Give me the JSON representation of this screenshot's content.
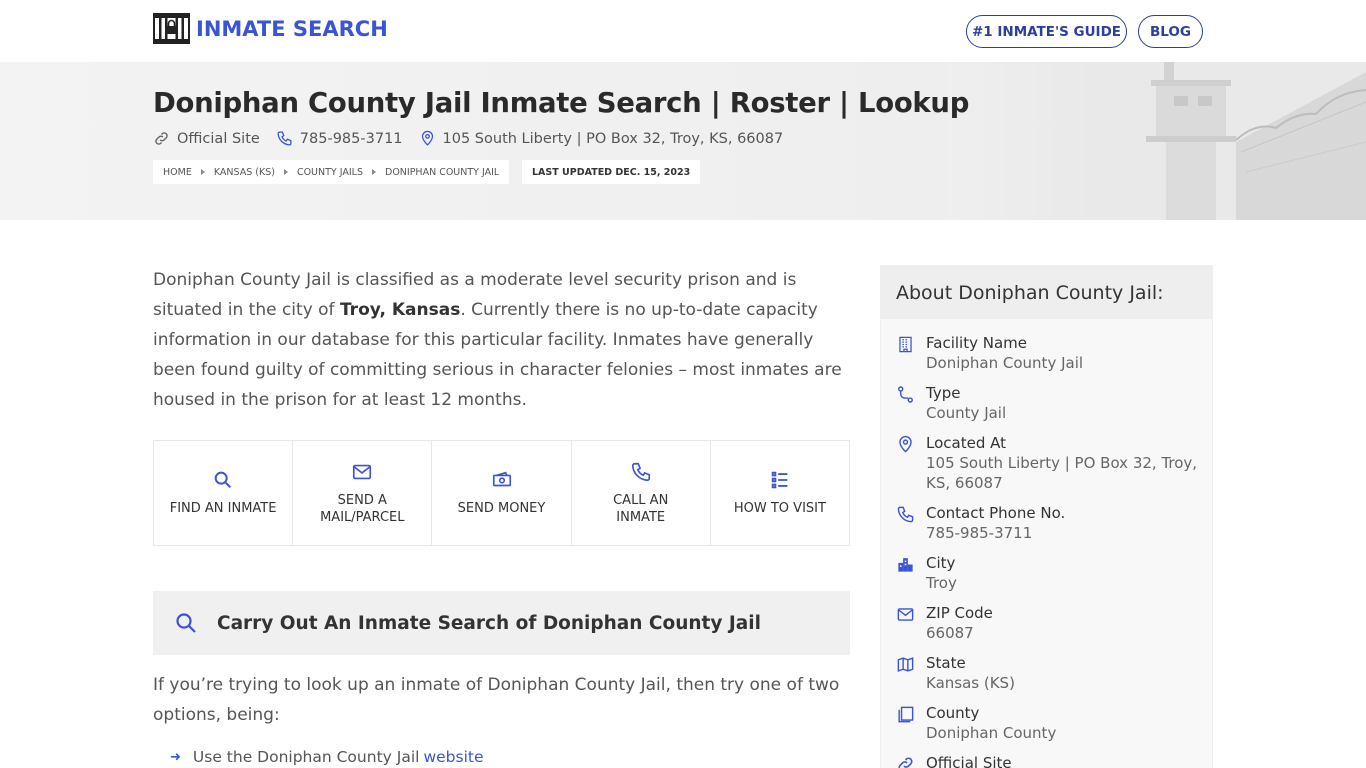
{
  "brand": {
    "name": "INMATE SEARCH"
  },
  "nav": {
    "guide": "#1 INMATE'S GUIDE",
    "blog": "BLOG"
  },
  "hero": {
    "title": "Doniphan County Jail Inmate Search | Roster | Lookup",
    "official_site": "Official Site",
    "phone": "785-985-3711",
    "address": "105 South Liberty | PO Box 32, Troy, KS, 66087",
    "breadcrumbs": [
      "HOME",
      "KANSAS (KS)",
      "COUNTY JAILS",
      "DONIPHAN COUNTY JAIL"
    ],
    "updated": "LAST UPDATED DEC. 15, 2023"
  },
  "intro": {
    "part1": "Doniphan County Jail is classified as a moderate level security prison and is situated in the city of ",
    "bold": "Troy, Kansas",
    "part2": ". Currently there is no up-to-date capacity information in our database for this particular facility. Inmates have generally been found guilty of committing serious in character felonies – most inmates are housed in the prison for at least 12 months."
  },
  "actions": [
    {
      "label": "FIND AN INMATE",
      "icon": "search-icon"
    },
    {
      "label": "SEND A MAIL/PARCEL",
      "icon": "mail-icon"
    },
    {
      "label": "SEND MONEY",
      "icon": "money-icon"
    },
    {
      "label": "CALL AN INMATE",
      "icon": "phone-icon"
    },
    {
      "label": "HOW TO VISIT",
      "icon": "list-icon"
    }
  ],
  "search_section": {
    "title": "Carry Out An Inmate Search of Doniphan County Jail"
  },
  "para2": "If you’re trying to look up an inmate of Doniphan County Jail, then try one of two options, being:",
  "bullet": {
    "text": "Use the Doniphan County Jail",
    "link": "website"
  },
  "sidebar": {
    "title": "About Doniphan County Jail:",
    "facts": [
      {
        "label": "Facility Name",
        "value": "Doniphan County Jail",
        "icon": "building-icon"
      },
      {
        "label": "Type",
        "value": "County Jail",
        "icon": "route-icon"
      },
      {
        "label": "Located At",
        "value": "105 South Liberty | PO Box 32, Troy, KS, 66087",
        "icon": "location-pin-icon"
      },
      {
        "label": "Contact Phone No.",
        "value": "785-985-3711",
        "icon": "phone-icon"
      },
      {
        "label": "City",
        "value": "Troy",
        "icon": "city-icon"
      },
      {
        "label": "ZIP Code",
        "value": "66087",
        "icon": "mail-icon"
      },
      {
        "label": "State",
        "value": "Kansas (KS)",
        "icon": "map-icon"
      },
      {
        "label": "County",
        "value": "Doniphan County",
        "icon": "copy-icon"
      },
      {
        "label": "Official Site",
        "value": "",
        "icon": "link-icon"
      }
    ]
  },
  "colors": {
    "accent": "#3b54d4",
    "nav_border": "#2a3fa0",
    "hero_bg": "#f0f0f0",
    "sidebar_bg": "#f8f8f8"
  }
}
